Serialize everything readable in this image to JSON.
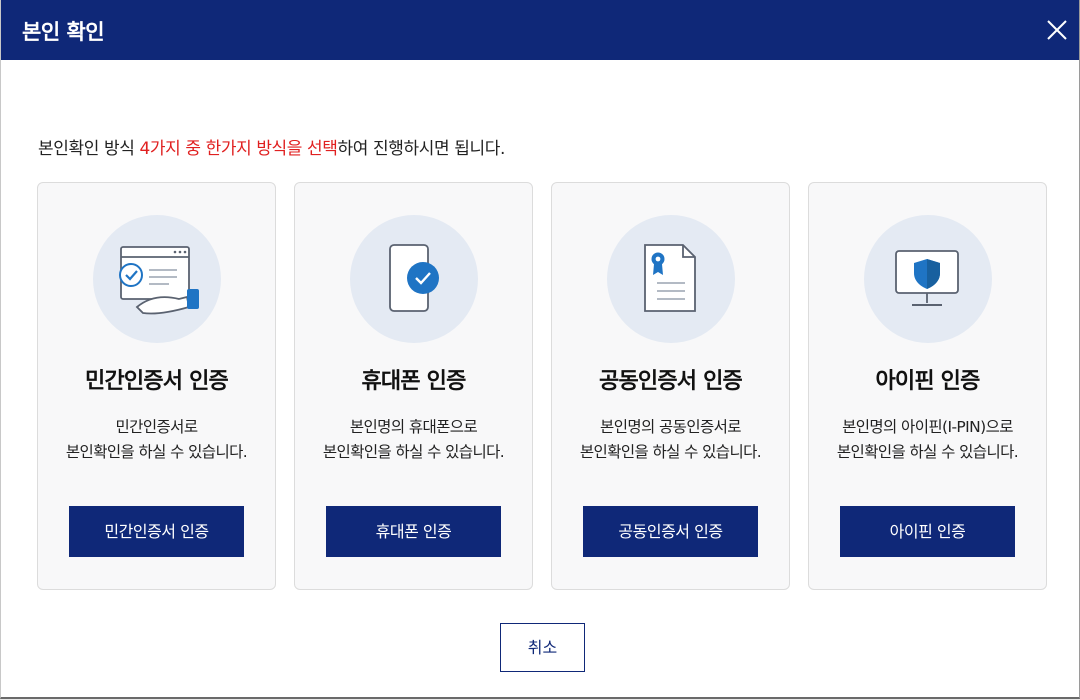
{
  "dialog": {
    "title": "본인 확인",
    "close_icon": "close-icon",
    "intro": {
      "before": "본인확인 방식 ",
      "highlight": "4가지 중 한가지 방식을 선택",
      "after": "하여 진행하시면 됩니다."
    },
    "colors": {
      "header": "#0f2878",
      "highlight": "#e02020",
      "button": "#0f2878",
      "icon_circle": "#e4eaf3",
      "icon_accent": "#1f74c4"
    },
    "cards": [
      {
        "icon": "certificate-hand-icon",
        "title": "민간인증서 인증",
        "desc_line1": "민간인증서로",
        "desc_line2": "본인확인을 하실 수 있습니다.",
        "button_label": "민간인증서 인증"
      },
      {
        "icon": "mobile-phone-check-icon",
        "title": "휴대폰 인증",
        "desc_line1": "본인명의 휴대폰으로",
        "desc_line2": "본인확인을 하실 수 있습니다.",
        "button_label": "휴대폰 인증"
      },
      {
        "icon": "document-seal-icon",
        "title": "공동인증서 인증",
        "desc_line1": "본인명의 공동인증서로",
        "desc_line2": "본인확인을 하실 수 있습니다.",
        "button_label": "공동인증서 인증"
      },
      {
        "icon": "monitor-shield-icon",
        "title": "아이핀 인증",
        "desc_line1": "본인명의 아이핀(I-PIN)으로",
        "desc_line2": "본인확인을 하실 수 있습니다.",
        "button_label": "아이핀 인증"
      }
    ],
    "cancel_label": "취소"
  }
}
